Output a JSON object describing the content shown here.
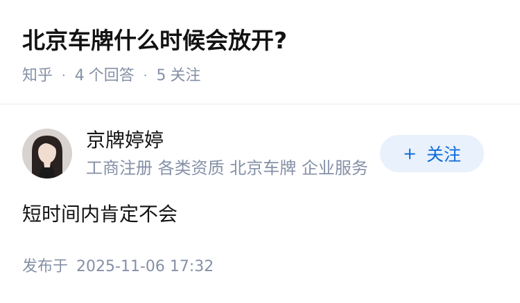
{
  "question": {
    "title": "北京车牌什么时候会放开?",
    "source": "知乎",
    "answer_count": "4",
    "answer_label": "个回答",
    "follow_count": "5",
    "follow_label": "关注"
  },
  "author": {
    "name": "京牌婷婷",
    "bio": "工商注册 各类资质 北京车牌 企业服务",
    "follow_button": "关注",
    "follow_icon": "plus-icon"
  },
  "answer": {
    "content": "短时间内肯定不会"
  },
  "publish": {
    "label": "发布于",
    "datetime": "2025-11-06 17:32"
  },
  "colors": {
    "title": "#121212",
    "meta": "#8590a6",
    "accent": "#0d6bd9",
    "button_bg": "#e8f1fc",
    "divider": "#ebebeb"
  }
}
